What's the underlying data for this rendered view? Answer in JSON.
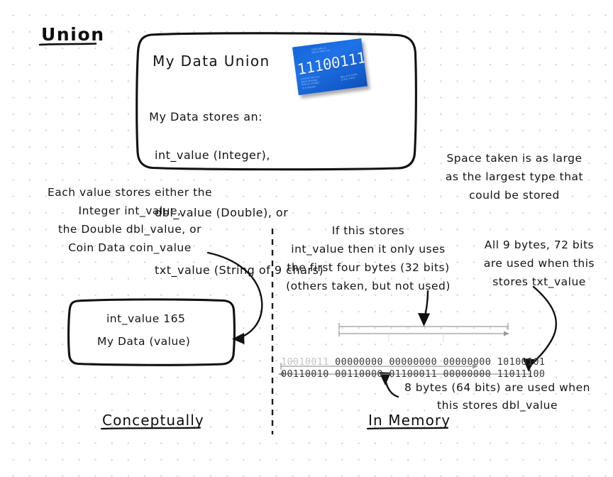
{
  "title": "Union",
  "card": {
    "heading": "My Data Union",
    "body_intro": "My Data stores an:",
    "fields": [
      "int_value (Integer),",
      "dbl_value (Double), or",
      "txt_value (String of 9 chars)"
    ],
    "image": {
      "name": "binary-data-card",
      "big_bits": "11100111",
      "micro_a": "Little data is\nstored here too",
      "micro_b": "A union lets the\nsame storage\nhold an integer\nor a double",
      "micro_c": "Bits and bytes\nof the value"
    }
  },
  "concept": {
    "note": "Each value stores either the\nInteger int_value,\nthe Double dbl_value, or\nCoin Data coin_value",
    "box": {
      "line1": "int_value 165",
      "line2": "My Data (value)"
    },
    "section_label": "Conceptually"
  },
  "memory": {
    "space_note": "Space taken is as large\nas the largest type that\ncould be stored",
    "int_note": "If this stores\nint_value then it only uses\nthe first four bytes (32 bits)\n(others taken, but not used)",
    "txt_note": "All 9 bytes, 72 bits\nare used when this\nstores txt_value",
    "dbl_note": "8 bytes (64 bits) are used when\nthis stores dbl_value",
    "section_label": "In Memory",
    "bits_row_1": {
      "faded_byte": "10010011",
      "bytes": [
        "00000000",
        "00000000",
        "00000000",
        "10100101"
      ]
    },
    "bits_row_2": {
      "bytes": [
        "00110010",
        "00110000",
        "01100011",
        "00000000",
        "11011100"
      ]
    }
  },
  "colors": {
    "ink": "#141414",
    "card_blue": "#1565d8",
    "faded_bits": "#c6c6c6",
    "bits": "#3a3a3a",
    "grid_dot": "#d8d8dd"
  }
}
